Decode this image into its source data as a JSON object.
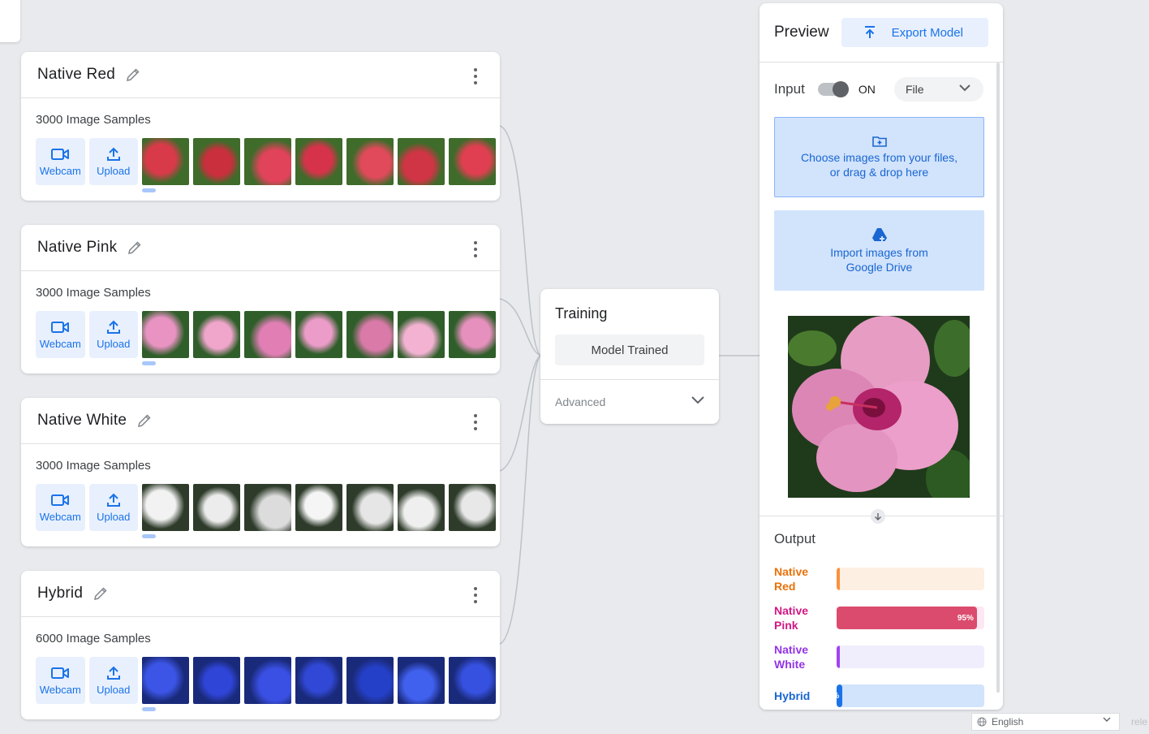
{
  "classes": [
    {
      "name": "Native Red",
      "samples": "3000 Image Samples",
      "webcam_label": "Webcam",
      "upload_label": "Upload",
      "thumb_palette": [
        "#d93a4a",
        "#c92f3c",
        "#e0435a",
        "#d6334a",
        "#e04a5a",
        "#cf3544",
        "#df3f50"
      ],
      "leaf_color": "#3f6b2b"
    },
    {
      "name": "Native Pink",
      "samples": "3000 Image Samples",
      "webcam_label": "Webcam",
      "upload_label": "Upload",
      "thumb_palette": [
        "#e993c2",
        "#f0a6cb",
        "#e17fb5",
        "#ec9cc8",
        "#d97aa8",
        "#f3b2d2",
        "#e690bd"
      ],
      "leaf_color": "#2f5e2a"
    },
    {
      "name": "Native White",
      "samples": "3000 Image Samples",
      "webcam_label": "Webcam",
      "upload_label": "Upload",
      "thumb_palette": [
        "#f2f2f2",
        "#ececec",
        "#dcdcdc",
        "#f5f5f5",
        "#e6e6e6",
        "#efefef",
        "#e8e8e8"
      ],
      "leaf_color": "#2e3b2a"
    },
    {
      "name": "Hybrid",
      "samples": "6000 Image Samples",
      "webcam_label": "Webcam",
      "upload_label": "Upload",
      "thumb_palette": [
        "#3c55e6",
        "#2f45d8",
        "#3a50e4",
        "#3148d6",
        "#2540c8",
        "#4060ee",
        "#3650df"
      ],
      "leaf_color": "#1a2a7a"
    }
  ],
  "training": {
    "title": "Training",
    "button_label": "Model Trained",
    "advanced_label": "Advanced"
  },
  "preview": {
    "title": "Preview",
    "export_label": "Export Model",
    "input_label": "Input",
    "toggle_state": "ON",
    "source_select": "File",
    "drop_text_1": "Choose images from your files,",
    "drop_text_2": "or drag & drop here",
    "drive_text_1": "Import images from",
    "drive_text_2": "Google Drive",
    "output_title": "Output",
    "outputs": [
      {
        "label_1": "Native",
        "label_2": "Red",
        "value": 0,
        "text": "",
        "color": "#e8710a",
        "track": "#feefe3",
        "fill": "#fa903e"
      },
      {
        "label_1": "Native",
        "label_2": "Pink",
        "value": 0.95,
        "text": "95%",
        "color": "#d01884",
        "track": "#fde7f3",
        "fill": "#db4b6e"
      },
      {
        "label_1": "Native",
        "label_2": "White",
        "value": 0,
        "text": "",
        "color": "#9334e6",
        "track": "#f0eefc",
        "fill": "#a142f4"
      },
      {
        "label_1": "Hybrid",
        "label_2": "",
        "value": 0.04,
        "text": "%",
        "color": "#1967d2",
        "track": "#d2e3fc",
        "fill": "#1a73e8"
      }
    ]
  },
  "footer": {
    "language": "English",
    "cut_text": "rele"
  },
  "colors": {
    "accent": "#1a73e8",
    "accent_bg": "#e8f0fe",
    "background": "#e8eaed"
  }
}
